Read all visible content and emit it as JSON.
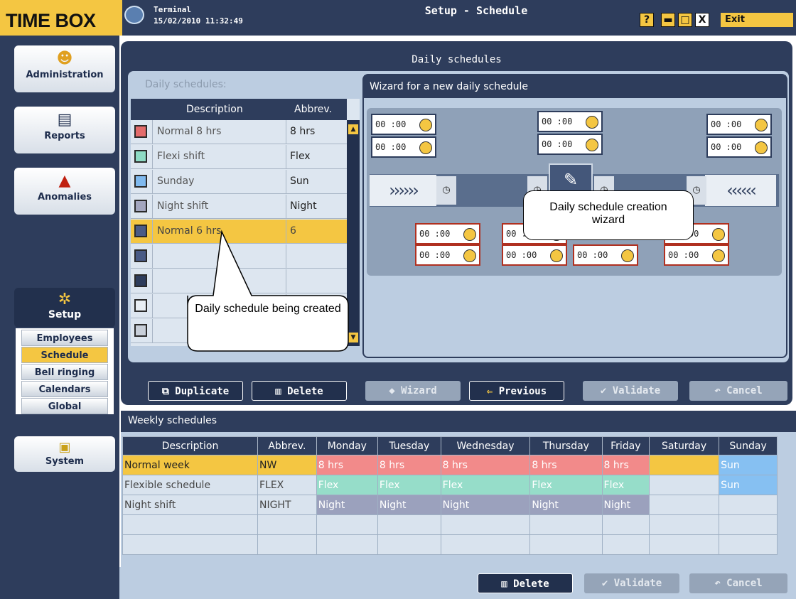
{
  "window": {
    "brand": "TIME BOX",
    "terminal_name": "Terminal",
    "terminal_datetime": "15/02/2010 11:32:49",
    "title": "Setup - Schedule",
    "help": "?",
    "minimize": "▬",
    "maximize": "□",
    "close": "X",
    "exit": "Exit"
  },
  "sidebar": {
    "items": [
      {
        "label": "Administration",
        "icon": "people-icon"
      },
      {
        "label": "Reports",
        "icon": "document-icon"
      },
      {
        "label": "Anomalies",
        "icon": "warning-icon"
      },
      {
        "label": "Setup",
        "icon": "gear-icon"
      },
      {
        "label": "System",
        "icon": "computer-icon"
      }
    ],
    "setup_subitems": [
      "Employees",
      "Schedule",
      "Bell ringing",
      "Calendars",
      "Global"
    ],
    "active_subitem": "Schedule"
  },
  "daily": {
    "panel_title": "Daily schedules",
    "list_label": "Daily schedules:",
    "columns": [
      "Description",
      "Abbrev."
    ],
    "rows": [
      {
        "desc": "Normal 8 hrs",
        "abbr": "8 hrs",
        "color": "#e36b6b"
      },
      {
        "desc": "Flexi shift",
        "abbr": "Flex",
        "color": "#8edbc5"
      },
      {
        "desc": "Sunday",
        "abbr": "Sun",
        "color": "#7fb9ee"
      },
      {
        "desc": "Night shift",
        "abbr": "Night",
        "color": "#a3a6bf"
      },
      {
        "desc": "Normal 6 hrs",
        "abbr": "6",
        "color": "#4a5b86"
      },
      {
        "desc": "",
        "abbr": "",
        "color": "#4a5b86"
      },
      {
        "desc": "",
        "abbr": "",
        "color": "#2e3d5c"
      },
      {
        "desc": "",
        "abbr": "",
        "color": "#e8eef4"
      },
      {
        "desc": "",
        "abbr": "",
        "color": "#c8cfd9"
      }
    ],
    "selected_row": 4
  },
  "wizard": {
    "title": "Wizard for a new daily schedule",
    "time_value": "00 :00"
  },
  "callouts": {
    "creation_wizard": "Daily schedule creation wizard",
    "being_created": "Daily schedule being created"
  },
  "actions": {
    "duplicate": "Duplicate",
    "delete": "Delete",
    "wizard": "Wizard",
    "previous": "Previous",
    "validate": "Validate",
    "cancel": "Cancel"
  },
  "weekly": {
    "title": "Weekly schedules",
    "columns": [
      "Description",
      "Abbrev.",
      "Monday",
      "Tuesday",
      "Wednesday",
      "Thursday",
      "Friday",
      "Saturday",
      "Sunday"
    ],
    "rows": [
      [
        "Normal week",
        "NW",
        "8 hrs",
        "8 hrs",
        "8 hrs",
        "8 hrs",
        "8 hrs",
        "",
        "Sun"
      ],
      [
        "Flexible schedule",
        "FLEX",
        "Flex",
        "Flex",
        "Flex",
        "Flex",
        "Flex",
        "",
        "Sun"
      ],
      [
        "Night shift",
        "NIGHT",
        "Night",
        "Night",
        "Night",
        "Night",
        "Night",
        "",
        ""
      ],
      [
        "",
        "",
        "",
        "",
        "",
        "",
        "",
        "",
        ""
      ],
      [
        "",
        "",
        "",
        "",
        "",
        "",
        "",
        "",
        ""
      ]
    ],
    "selected_row": 0,
    "colors": {
      "8 hrs": "#f28a8a",
      "Flex": "#96ddc9",
      "Sun": "#86c0f2",
      "Night": "#9ba1bd"
    }
  },
  "bottom_actions": {
    "delete": "Delete",
    "validate": "Validate",
    "cancel": "Cancel"
  }
}
